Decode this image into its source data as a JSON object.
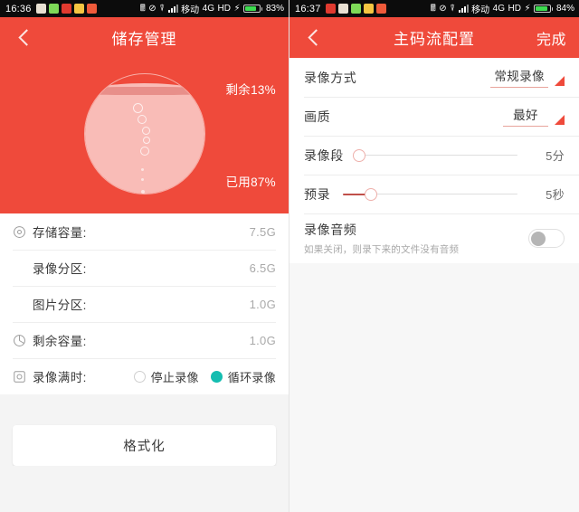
{
  "left": {
    "statusbar": {
      "time": "16:36",
      "battery_text": "83%",
      "battery_level": 83,
      "carrier": "移动",
      "network": "4G",
      "hd": "HD",
      "app_icons": [
        "app-icon-1",
        "app-icon-2",
        "app-icon-3",
        "app-icon-4",
        "app-icon-5"
      ],
      "icons": [
        "bluetooth-icon",
        "mute-icon",
        "wifi-icon",
        "signal-icon",
        "charging-icon",
        "battery-icon"
      ]
    },
    "nav": {
      "back": "back-chevron-icon",
      "title": "储存管理"
    },
    "gauge": {
      "remaining_label": "剩余13%",
      "used_label": "已用87%",
      "used_percent": 87,
      "remaining_percent": 13,
      "fill_color": "#f9bcb7",
      "bg_color": "#ef4a3b"
    },
    "rows": [
      {
        "icon": "disc-icon",
        "label": "存储容量:",
        "value": "7.5G"
      },
      {
        "icon": "",
        "label": "录像分区:",
        "value": "6.5G"
      },
      {
        "icon": "",
        "label": "图片分区:",
        "value": "1.0G"
      },
      {
        "icon": "pie-chart-icon",
        "label": "剩余容量:",
        "value": "1.0G"
      }
    ],
    "full_row": {
      "icon": "record-square-icon",
      "label": "录像满时:",
      "options": [
        {
          "label": "停止录像",
          "selected": false
        },
        {
          "label": "循环录像",
          "selected": true
        }
      ],
      "selected_color": "#14bdb0"
    },
    "format_button": "格式化"
  },
  "right": {
    "statusbar": {
      "time": "16:37",
      "battery_text": "84%",
      "battery_level": 84,
      "carrier": "移动",
      "network": "4G",
      "hd": "HD",
      "app_icons": [
        "app-icon-1",
        "app-icon-2",
        "app-icon-3",
        "app-icon-4",
        "app-icon-5"
      ],
      "icons": [
        "bluetooth-icon",
        "mute-icon",
        "wifi-icon",
        "signal-icon",
        "charging-icon",
        "battery-icon"
      ]
    },
    "nav": {
      "back": "back-chevron-icon",
      "title": "主码流配置",
      "done": "完成"
    },
    "spinners": [
      {
        "label": "录像方式",
        "value": "常规录像"
      },
      {
        "label": "画质",
        "value": "最好"
      }
    ],
    "sliders": [
      {
        "label": "录像段",
        "value": "5分",
        "percent": 0
      },
      {
        "label": "预录",
        "value": "5秒",
        "percent": 16
      }
    ],
    "toggle": {
      "title": "录像音频",
      "subtitle": "如果关闭，则录下来的文件没有音频",
      "on": false
    }
  },
  "colors": {
    "accent_red": "#ef4a3b",
    "teal": "#14bdb0",
    "page_gray": "#f4f4f4"
  }
}
